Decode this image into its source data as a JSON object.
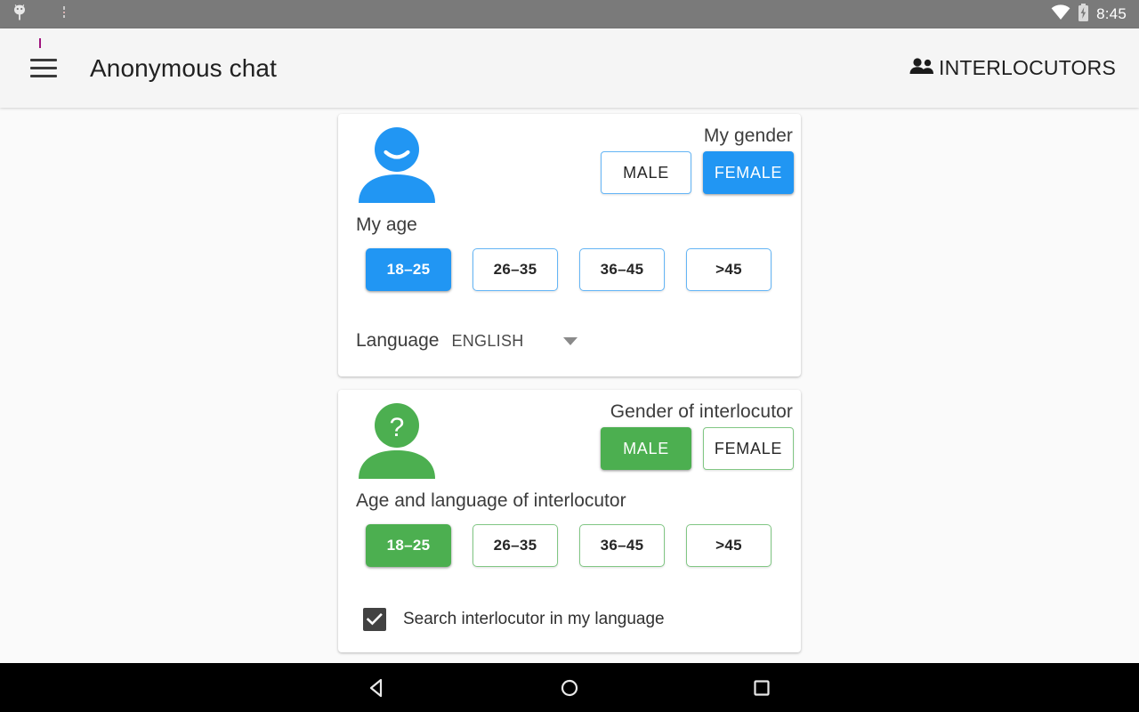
{
  "status_bar": {
    "clock": "8:45",
    "icons": [
      "android-notification-icon",
      "more-notification-icon",
      "wifi-icon",
      "battery-charging-icon"
    ]
  },
  "app_bar": {
    "menu_icon": "hamburger-menu-icon",
    "title": "Anonymous chat",
    "action_icon": "people-group-icon",
    "action_label": "INTERLOCUTORS"
  },
  "colors": {
    "self_accent": "#2196f3",
    "interlocutor_accent": "#4caf50",
    "self_accent_border": "#64b5f6",
    "interlocutor_accent_border": "#81c784",
    "status_bar_bg": "#7a7a7a",
    "app_bar_bg": "#f5f5f5",
    "page_bg": "#fafafa",
    "nav_bar_bg": "#000000",
    "checkbox_fill": "#424242"
  },
  "self_card": {
    "avatar_icon": "person-smiling-avatar-icon",
    "gender_title": "My gender",
    "gender_options": [
      {
        "label": "MALE",
        "selected": false
      },
      {
        "label": "FEMALE",
        "selected": true
      }
    ],
    "age_title": "My age",
    "age_options": [
      {
        "label": "18–25",
        "selected": true
      },
      {
        "label": "26–35",
        "selected": false
      },
      {
        "label": "36–45",
        "selected": false
      },
      {
        "label": ">45",
        "selected": false
      }
    ],
    "language_label": "Language",
    "language_value": "ENGLISH",
    "language_caret_icon": "chevron-down-icon"
  },
  "interlocutor_card": {
    "avatar_icon": "person-question-avatar-icon",
    "gender_title": "Gender of interlocutor",
    "gender_options": [
      {
        "label": "MALE",
        "selected": true
      },
      {
        "label": "FEMALE",
        "selected": false
      }
    ],
    "age_title": "Age and language of interlocutor",
    "age_options": [
      {
        "label": "18–25",
        "selected": true
      },
      {
        "label": "26–35",
        "selected": false
      },
      {
        "label": "36–45",
        "selected": false
      },
      {
        "label": ">45",
        "selected": false
      }
    ],
    "checkbox": {
      "label": "Search interlocutor in my language",
      "checked": true
    }
  },
  "nav_bar": {
    "back": "back-triangle-icon",
    "home": "home-circle-icon",
    "recents": "recents-square-icon"
  }
}
